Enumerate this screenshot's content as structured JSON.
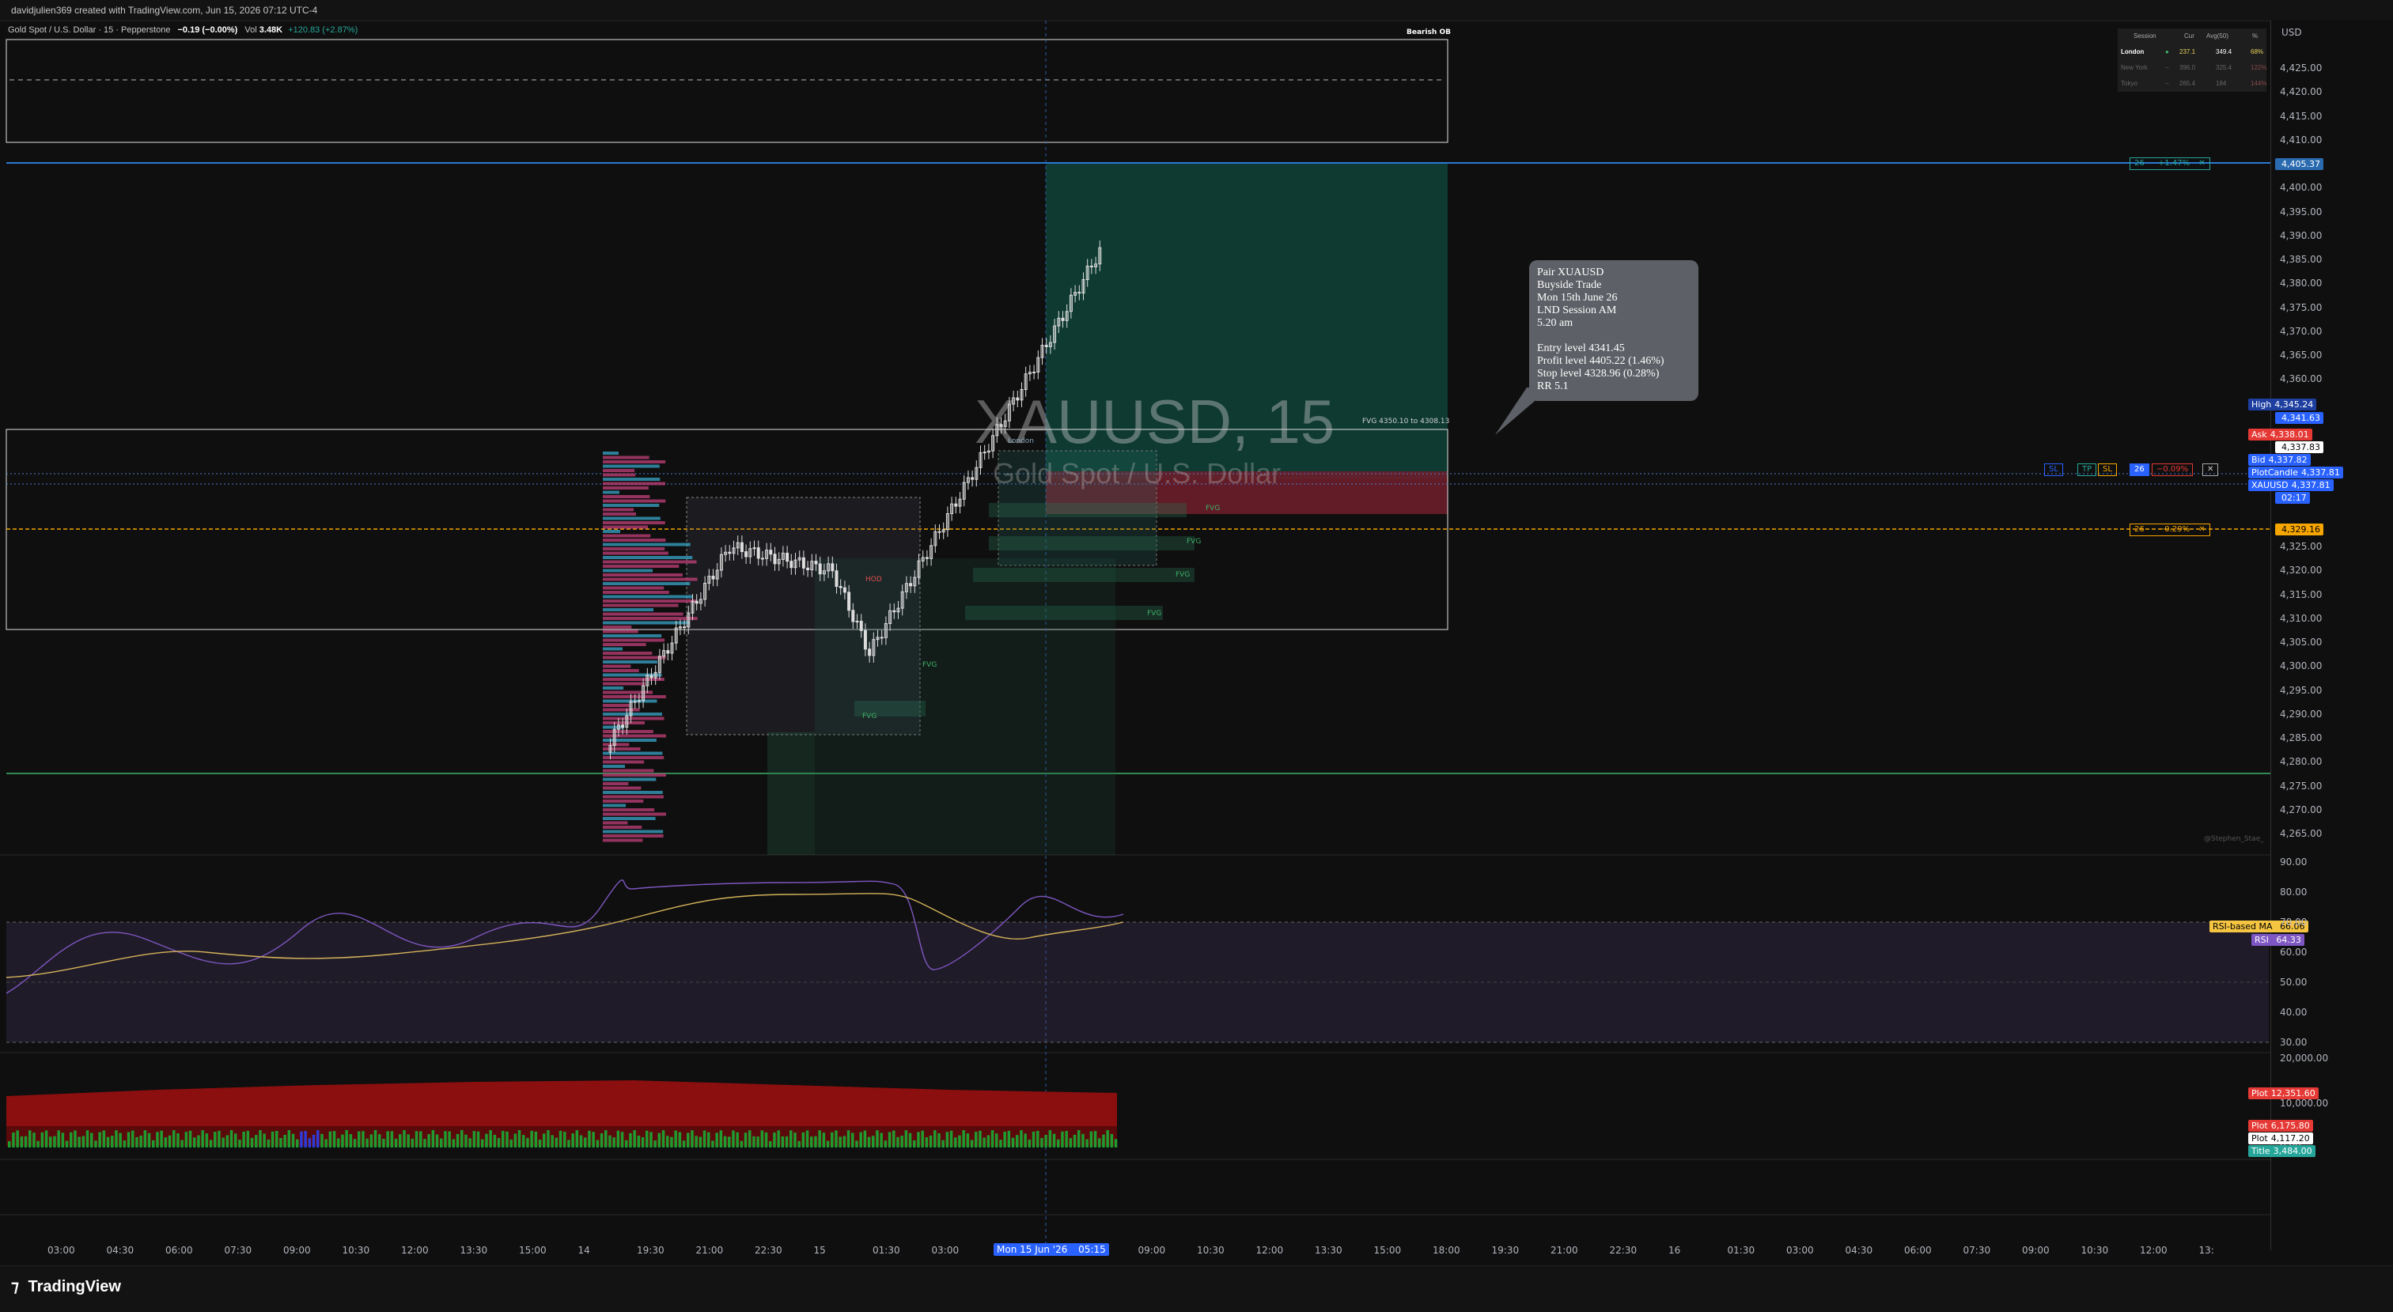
{
  "top_bar": {
    "text": "davidjulien369 created with TradingView.com, Jun 15, 2026 07:12 UTC-4"
  },
  "legend": {
    "title": "Gold Spot / U.S. Dollar · 15 · Pepperstone",
    "change": "−0.19 (−0.00%)",
    "vol_label": "Vol",
    "vol_value": "3.48K",
    "vol_change": "+120.83 (+2.87%)"
  },
  "bearish_ob_label": "Bearish OB",
  "watermark": {
    "symbol": "XAUUSD, 15",
    "name": "Gold Spot / U.S. Dollar"
  },
  "note": {
    "lines": [
      "Pair XUAUSD",
      "Buyside Trade",
      "Mon 15th June 26",
      "LND Session AM",
      "5.20 am",
      "",
      "Entry level 4341.45",
      "Profit level 4405.22 (1.46%)",
      "Stop level 4328.96 (0.28%)",
      "RR 5.1"
    ]
  },
  "session_table": {
    "headers": [
      "Session",
      "Cur",
      "Avg(50)",
      "%"
    ],
    "rows": [
      {
        "name": "London",
        "dot": "●",
        "cur": "237.1",
        "avg": "349.4",
        "pct": "68%"
      },
      {
        "name": "New York",
        "dot": "–",
        "cur": "396.0",
        "avg": "325.4",
        "pct": "122%"
      },
      {
        "name": "Tokyo",
        "dot": "–",
        "cur": "265.4",
        "avg": "184",
        "pct": "144%"
      }
    ]
  },
  "fvg_top_label": "FVG 4350.10 to 4308.13",
  "fvg_labels": [
    "FVG",
    "FVG",
    "FVG",
    "FVG",
    "FVG",
    "FVG"
  ],
  "hod_label": "HOD",
  "london_label": "London",
  "position_tags": {
    "target": {
      "qty": "26",
      "pct": "+1.47%",
      "x": "✕"
    },
    "stop": {
      "qty": "26",
      "pct": "−0.29%",
      "x": "✕"
    },
    "order": {
      "sl": "SL",
      "tp": "TP",
      "sl2": "SL",
      "qty": "26",
      "pct": "−0.09%",
      "x": "✕"
    }
  },
  "price_axis": {
    "currency": "USD",
    "ticks": [
      "4,425.00",
      "4,420.00",
      "4,415.00",
      "4,410.00",
      "4,400.00",
      "4,395.00",
      "4,390.00",
      "4,385.00",
      "4,380.00",
      "4,375.00",
      "4,370.00",
      "4,365.00",
      "4,360.00",
      "4,325.00",
      "4,320.00",
      "4,315.00",
      "4,310.00",
      "4,305.00",
      "4,300.00",
      "4,295.00",
      "4,290.00",
      "4,285.00",
      "4,280.00",
      "4,275.00",
      "4,270.00",
      "4,265.00"
    ],
    "tags": [
      {
        "label": "",
        "value": "4,405.37",
        "color": "#2a6bb0"
      },
      {
        "label": "High",
        "value": "4,345.24",
        "color": "#1e3fa0"
      },
      {
        "label": "",
        "value": "4,341.63",
        "color": "#2962ff"
      },
      {
        "label": "",
        "value": "4,337.83",
        "color": "#ffffff"
      },
      {
        "label": "Ask",
        "value": "4,338.01",
        "color": "#e53935"
      },
      {
        "label": "Bid",
        "value": "4,337.82",
        "color": "#2962ff"
      },
      {
        "label": "PlotCandle",
        "value": "4,337.81",
        "color": "#2962ff"
      },
      {
        "label": "XAUUSD",
        "value": "4,337.81",
        "color": "#2962ff"
      },
      {
        "label": "",
        "value": "02:17",
        "color": "#2962ff"
      },
      {
        "label": "",
        "value": "4,329.16",
        "color": "#f7a600"
      }
    ]
  },
  "rsi_axis": {
    "ticks": [
      "90.00",
      "80.00",
      "70.00",
      "60.00",
      "50.00",
      "40.00",
      "30.00"
    ],
    "ma_label": "RSI-based MA",
    "ma_value": "66.06",
    "rsi_label": "RSI",
    "rsi_value": "64.33"
  },
  "vol_axis": {
    "ticks": [
      "20,000.00",
      "10,000.00",
      "0.00"
    ],
    "tags": [
      {
        "label": "Plot",
        "value": "12,351.60",
        "color": "#e53935"
      },
      {
        "label": "Plot",
        "value": "6,175.80",
        "color": "#e53935"
      },
      {
        "label": "Plot",
        "value": "4,117.20",
        "color": "#ffffff"
      },
      {
        "label": "Title",
        "value": "3,484.00",
        "color": "#26a69a"
      }
    ]
  },
  "time_axis": {
    "labels": [
      "03:00",
      "04:30",
      "06:00",
      "07:30",
      "09:00",
      "10:30",
      "12:00",
      "13:30",
      "15:00",
      "14",
      "19:30",
      "21:00",
      "22:30",
      "15",
      "01:30",
      "03:00",
      "07:30",
      "09:00",
      "10:30",
      "12:00",
      "13:30",
      "15:00",
      "18:00",
      "19:30",
      "21:00",
      "22:30",
      "16",
      "01:30",
      "03:00",
      "04:30",
      "06:00",
      "07:30",
      "09:00",
      "10:30",
      "12:00",
      "13:"
    ],
    "cursor": "Mon 15 Jun '26",
    "cursor_time": "05:15"
  },
  "signature": "@Stephen_Stae_",
  "brand": "TradingView",
  "colors": {
    "bg": "#0f0f0f",
    "target_zone": "#0f3d34",
    "stop_zone": "#6b1e2a",
    "blue_line": "#2a79d4",
    "orange_line": "#f7a600",
    "green_line": "#3fb068"
  }
}
